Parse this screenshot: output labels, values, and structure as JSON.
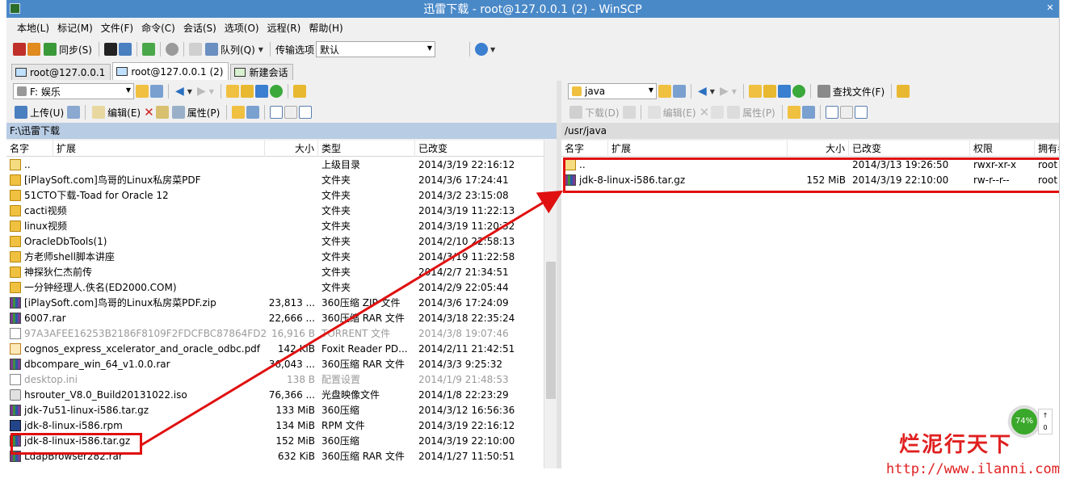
{
  "window": {
    "title": "迅雷下载 - root@127.0.0.1 (2) - WinSCP"
  },
  "menu": [
    "本地(L)",
    "标记(M)",
    "文件(F)",
    "命令(C)",
    "会话(S)",
    "选项(O)",
    "远程(R)",
    "帮助(H)"
  ],
  "toolbar": {
    "sync_label": "同步(S)",
    "queue_label": "队列(Q)",
    "transfer_options_label": "传输选项",
    "transfer_preset": "默认"
  },
  "tabs": [
    "root@127.0.0.1",
    "root@127.0.0.1 (2)",
    "新建会话"
  ],
  "local": {
    "drive": "F: 娱乐",
    "toolbar": {
      "upload": "上传(U)",
      "edit": "编辑(E)",
      "properties": "属性(P)"
    },
    "path": "F:\\迅雷下载",
    "columns": {
      "name": "名字",
      "ext": "扩展",
      "size": "大小",
      "type": "类型",
      "changed": "已改变"
    },
    "files": [
      {
        "name": "..",
        "size": "",
        "type": "上级目录",
        "changed": "2014/3/19  22:16:12",
        "icon": "updir"
      },
      {
        "name": "[iPlaySoft.com]鸟哥的Linux私房菜PDF",
        "size": "",
        "type": "文件夹",
        "changed": "2014/3/6  17:24:41",
        "icon": "folder"
      },
      {
        "name": "51CTO下载-Toad for Oracle 12",
        "size": "",
        "type": "文件夹",
        "changed": "2014/3/2  23:15:08",
        "icon": "folder"
      },
      {
        "name": "cacti视频",
        "size": "",
        "type": "文件夹",
        "changed": "2014/3/19  11:22:13",
        "icon": "folder"
      },
      {
        "name": "linux视频",
        "size": "",
        "type": "文件夹",
        "changed": "2014/3/19  11:20:32",
        "icon": "folder"
      },
      {
        "name": "OracleDbTools(1)",
        "size": "",
        "type": "文件夹",
        "changed": "2014/2/10  22:58:13",
        "icon": "folder"
      },
      {
        "name": "方老师shell脚本讲座",
        "size": "",
        "type": "文件夹",
        "changed": "2014/3/19  11:22:58",
        "icon": "folder"
      },
      {
        "name": "神探狄仁杰前传",
        "size": "",
        "type": "文件夹",
        "changed": "2014/2/7  21:34:51",
        "icon": "folder"
      },
      {
        "name": "一分钟经理人.佚名(ED2000.COM)",
        "size": "",
        "type": "文件夹",
        "changed": "2014/2/9  22:05:44",
        "icon": "folder"
      },
      {
        "name": "[iPlaySoft.com]鸟哥的Linux私房菜PDF.zip",
        "size": "23,813 ...",
        "type": "360压缩 ZIP 文件",
        "changed": "2014/3/6  17:24:09",
        "icon": "archive"
      },
      {
        "name": "6007.rar",
        "size": "22,666 ...",
        "type": "360压缩 RAR 文件",
        "changed": "2014/3/18  22:35:24",
        "icon": "archive"
      },
      {
        "name": "97A3AFEE16253B2186F8109F2FDCFBC87864FD2...",
        "size": "16,916 B",
        "type": "TORRENT 文件",
        "changed": "2014/3/8  19:07:46",
        "icon": "doc",
        "dim": true
      },
      {
        "name": "cognos_express_xcelerator_and_oracle_odbc.pdf",
        "size": "142 KiB",
        "type": "Foxit Reader PD...",
        "changed": "2014/2/11  21:42:51",
        "icon": "pdf"
      },
      {
        "name": "dbcompare_win_64_v1.0.0.rar",
        "size": "36,043 ...",
        "type": "360压缩 RAR 文件",
        "changed": "2014/3/3  9:25:32",
        "icon": "archive"
      },
      {
        "name": "desktop.ini",
        "size": "138 B",
        "type": "配置设置",
        "changed": "2014/1/9  21:48:53",
        "icon": "doc",
        "dim": true
      },
      {
        "name": "hsrouter_V8.0_Build20131022.iso",
        "size": "76,366 ...",
        "type": "光盘映像文件",
        "changed": "2014/1/8  22:23:29",
        "icon": "disk"
      },
      {
        "name": "jdk-7u51-linux-i586.tar.gz",
        "size": "133 MiB",
        "type": "360压缩",
        "changed": "2014/3/12  16:56:36",
        "icon": "archive"
      },
      {
        "name": "jdk-8-linux-i586.rpm",
        "size": "134 MiB",
        "type": "RPM 文件",
        "changed": "2014/3/19  22:16:12",
        "icon": "rpm"
      },
      {
        "name": "jdk-8-linux-i586.tar.gz",
        "size": "152 MiB",
        "type": "360压缩",
        "changed": "2014/3/19  22:10:00",
        "icon": "archive"
      },
      {
        "name": "LdapBrowser282.rar",
        "size": "632 KiB",
        "type": "360压缩 RAR 文件",
        "changed": "2014/1/27  11:50:51",
        "icon": "archive"
      }
    ]
  },
  "remote": {
    "dir": "java",
    "find_files": "查找文件(F)",
    "toolbar": {
      "download": "下载(D)",
      "edit": "编辑(E)",
      "properties": "属性(P)"
    },
    "path": "/usr/java",
    "columns": {
      "name": "名字",
      "ext": "扩展",
      "size": "大小",
      "changed": "已改变",
      "perms": "权限",
      "owner": "拥有者"
    },
    "files": [
      {
        "name": "..",
        "size": "",
        "changed": "2014/3/13 19:26:50",
        "perms": "rwxr-xr-x",
        "owner": "root",
        "icon": "updir"
      },
      {
        "name": "jdk-8-linux-i586.tar.gz",
        "size": "152 MiB",
        "changed": "2014/3/19 22:10:00",
        "perms": "rw-r--r--",
        "owner": "root",
        "icon": "archive"
      }
    ]
  },
  "speed_widget": {
    "percent": "74%",
    "up": "↑",
    "down": "0"
  },
  "watermark": {
    "brand": "烂泥行天下",
    "url": "http://www.ilanni.com"
  },
  "colors": {
    "title_bar": "#4a89c8",
    "path_active": "#b8cce4",
    "highlight": "#e01010"
  }
}
